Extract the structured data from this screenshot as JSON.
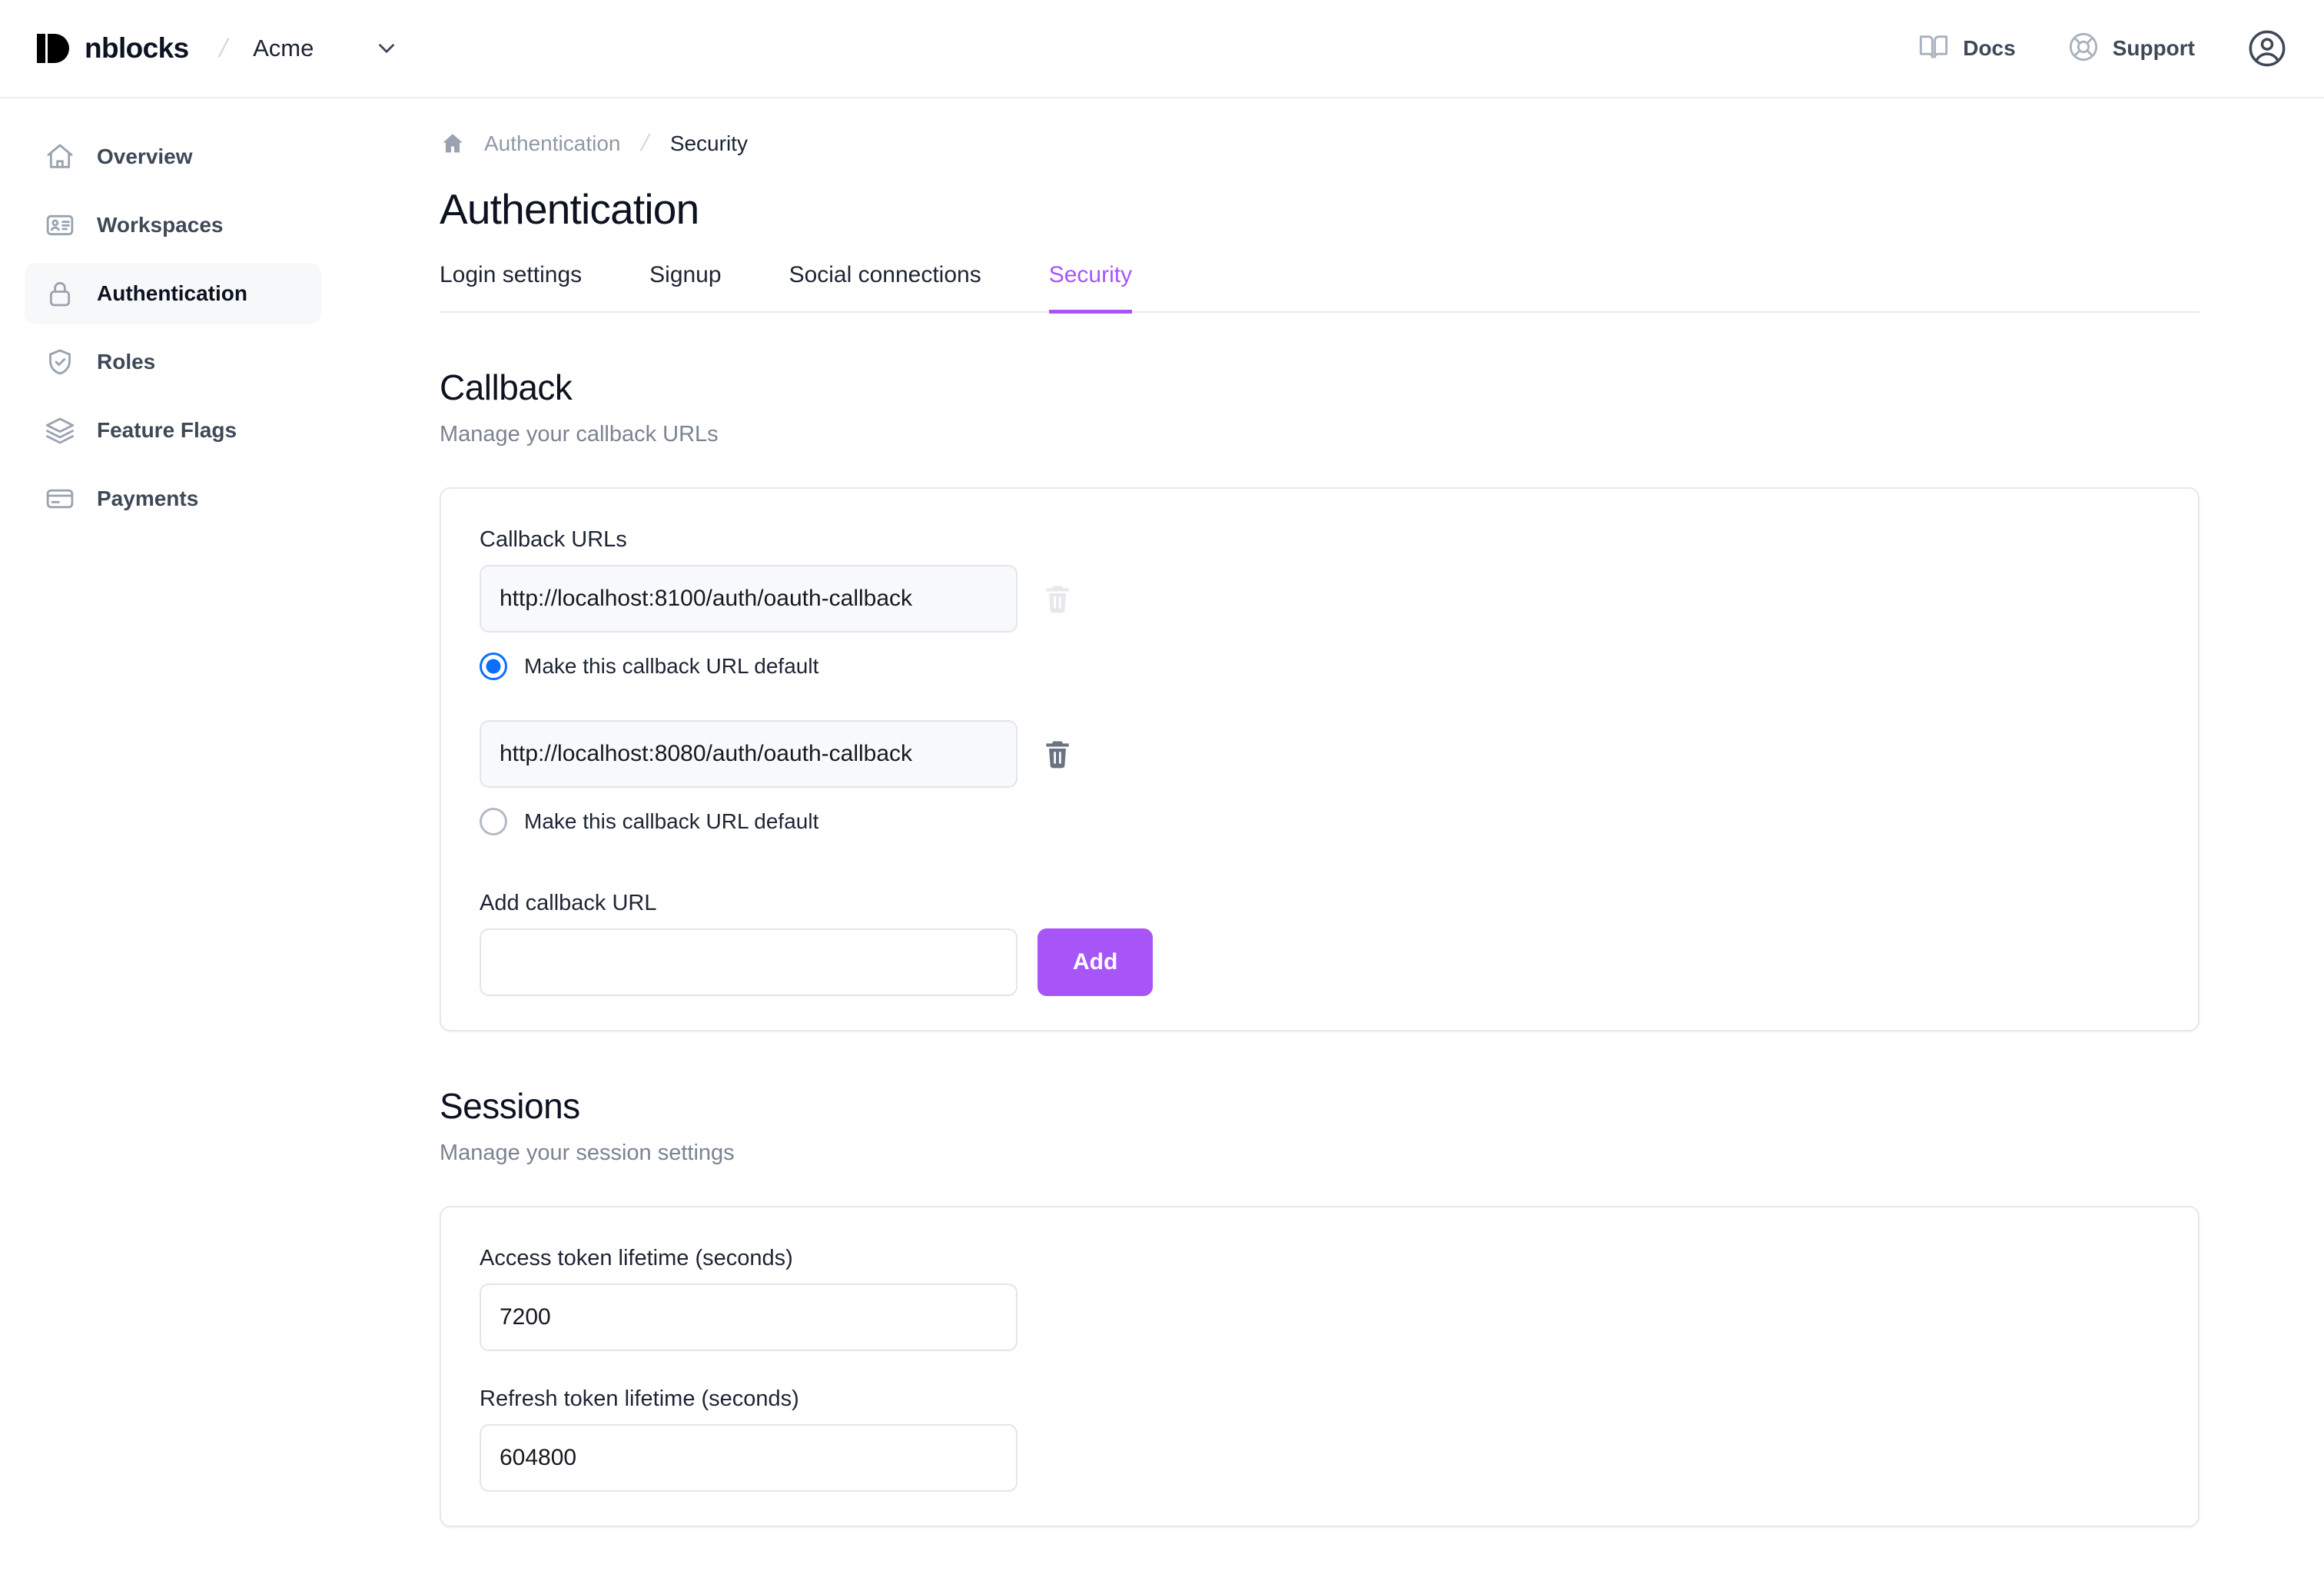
{
  "header": {
    "brand_name": "nblocks",
    "separator": "/",
    "org_name": "Acme",
    "org_caret_icon": "chevron-down-icon",
    "docs_label": "Docs",
    "docs_icon": "book-icon",
    "support_label": "Support",
    "support_icon": "lifebuoy-icon",
    "avatar_icon": "user-circle-icon"
  },
  "sidebar": {
    "items": [
      {
        "label": "Overview",
        "icon": "home-icon",
        "active": false
      },
      {
        "label": "Workspaces",
        "icon": "id-card-icon",
        "active": false
      },
      {
        "label": "Authentication",
        "icon": "lock-icon",
        "active": true
      },
      {
        "label": "Roles",
        "icon": "shield-check-icon",
        "active": false
      },
      {
        "label": "Feature Flags",
        "icon": "layers-icon",
        "active": false
      },
      {
        "label": "Payments",
        "icon": "credit-card-icon",
        "active": false
      }
    ]
  },
  "breadcrumb": {
    "home_icon": "home-icon",
    "parent": "Authentication",
    "separator": "/",
    "current": "Security"
  },
  "page": {
    "title": "Authentication",
    "tabs": [
      {
        "label": "Login settings",
        "active": false
      },
      {
        "label": "Signup",
        "active": false
      },
      {
        "label": "Social connections",
        "active": false
      },
      {
        "label": "Security",
        "active": true
      }
    ]
  },
  "callback": {
    "title": "Callback",
    "subtitle": "Manage your callback URLs",
    "urls_label": "Callback URLs",
    "entries": [
      {
        "value": "http://localhost:8100/auth/oauth-callback",
        "radio_label": "Make this callback URL default",
        "default_selected": true,
        "delete_icon": "trash-icon",
        "delete_disabled": true
      },
      {
        "value": "http://localhost:8080/auth/oauth-callback",
        "radio_label": "Make this callback URL default",
        "default_selected": false,
        "delete_icon": "trash-icon",
        "delete_disabled": false
      }
    ],
    "add_label": "Add callback URL",
    "add_value": "",
    "add_placeholder": "",
    "add_button": "Add"
  },
  "sessions": {
    "title": "Sessions",
    "subtitle": "Manage your session settings",
    "access_token_label": "Access token lifetime (seconds)",
    "access_token_value": "7200",
    "refresh_token_label": "Refresh token lifetime (seconds)",
    "refresh_token_value": "604800"
  },
  "colors": {
    "accent_purple": "#a855f7",
    "radio_blue": "#0d6efd",
    "text_dark": "#0d1220",
    "text_muted": "#7b8391",
    "border": "#e6e8ec",
    "active_nav_bg": "#f6f8fa"
  }
}
